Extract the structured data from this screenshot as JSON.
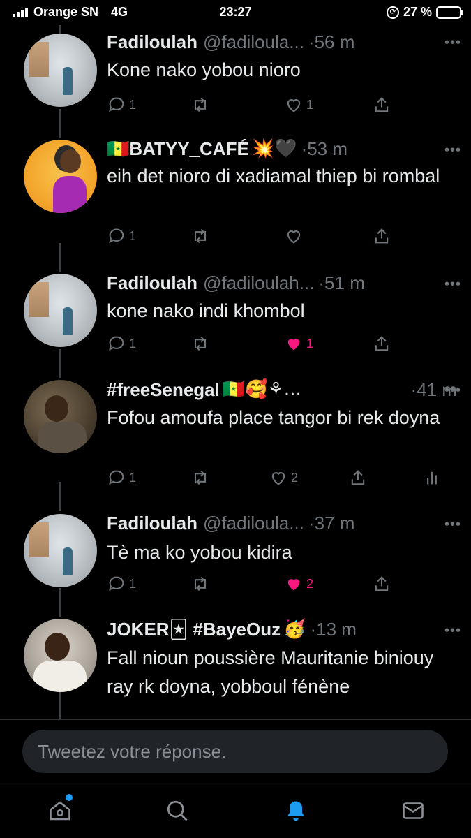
{
  "status_bar": {
    "carrier": "Orange SN",
    "network": "4G",
    "time": "23:27",
    "battery_percent": "27 %",
    "battery_level": 0.27,
    "battery_color": "#ffd60a"
  },
  "tweets": [
    {
      "name": "Fadiloulah",
      "handle": "@fadiloula...",
      "time": "·56 m",
      "text": "Kone nako yobou nioro",
      "avatar": "street-protest-photo",
      "replies": "1",
      "retweets": "",
      "likes": "1",
      "liked": false
    },
    {
      "name": "🇸🇳BATYY_CAFÉ",
      "emojis": "💥🖤",
      "handle": "",
      "time": "·53 m",
      "text": "eih det nioro di xadiamal thiep bi rombal",
      "avatar": "man-purple-hoodie-photo",
      "replies": "1",
      "retweets": "",
      "likes": "",
      "liked": false
    },
    {
      "name": "Fadiloulah",
      "handle": "@fadiloulah...",
      "time": "·51 m",
      "text": "kone nako indi khombol",
      "avatar": "street-protest-photo",
      "replies": "1",
      "retweets": "",
      "likes": "1",
      "liked": true
    },
    {
      "name": "#freeSenegal",
      "emojis": "🇸🇳🥰⚘...",
      "handle": "",
      "time": "·41 m",
      "text": "Fofou amoufa place tangor bi rek doyna",
      "avatar": "man-portrait-photo",
      "replies": "1",
      "retweets": "",
      "likes": "2",
      "liked": false,
      "has_analytics": true
    },
    {
      "name": "Fadiloulah",
      "handle": "@fadiloula...",
      "time": "·37 m",
      "text": "Tè ma ko yobou kidira",
      "avatar": "street-protest-photo",
      "replies": "1",
      "retweets": "",
      "likes": "2",
      "liked": true
    },
    {
      "name": "JOKER🃏 #BayeOuz",
      "emojis": "🥳",
      "handle": "",
      "time": "·13 m",
      "text": "Fall nioun poussière Mauritanie biniouy ray rk doyna, yobboul fénène",
      "avatar": "men-in-car-photo",
      "replies": "",
      "retweets": "",
      "likes": "",
      "liked": false
    }
  ],
  "reply": {
    "placeholder": "Tweetez votre réponse."
  },
  "tabs": [
    {
      "name": "home-icon",
      "has_dot": true
    },
    {
      "name": "search-icon"
    },
    {
      "name": "notifications-icon",
      "active": true
    },
    {
      "name": "messages-icon"
    }
  ],
  "colors": {
    "accent": "#1d9bf0",
    "like": "#f91880",
    "muted": "#71767b",
    "background": "#000000"
  }
}
